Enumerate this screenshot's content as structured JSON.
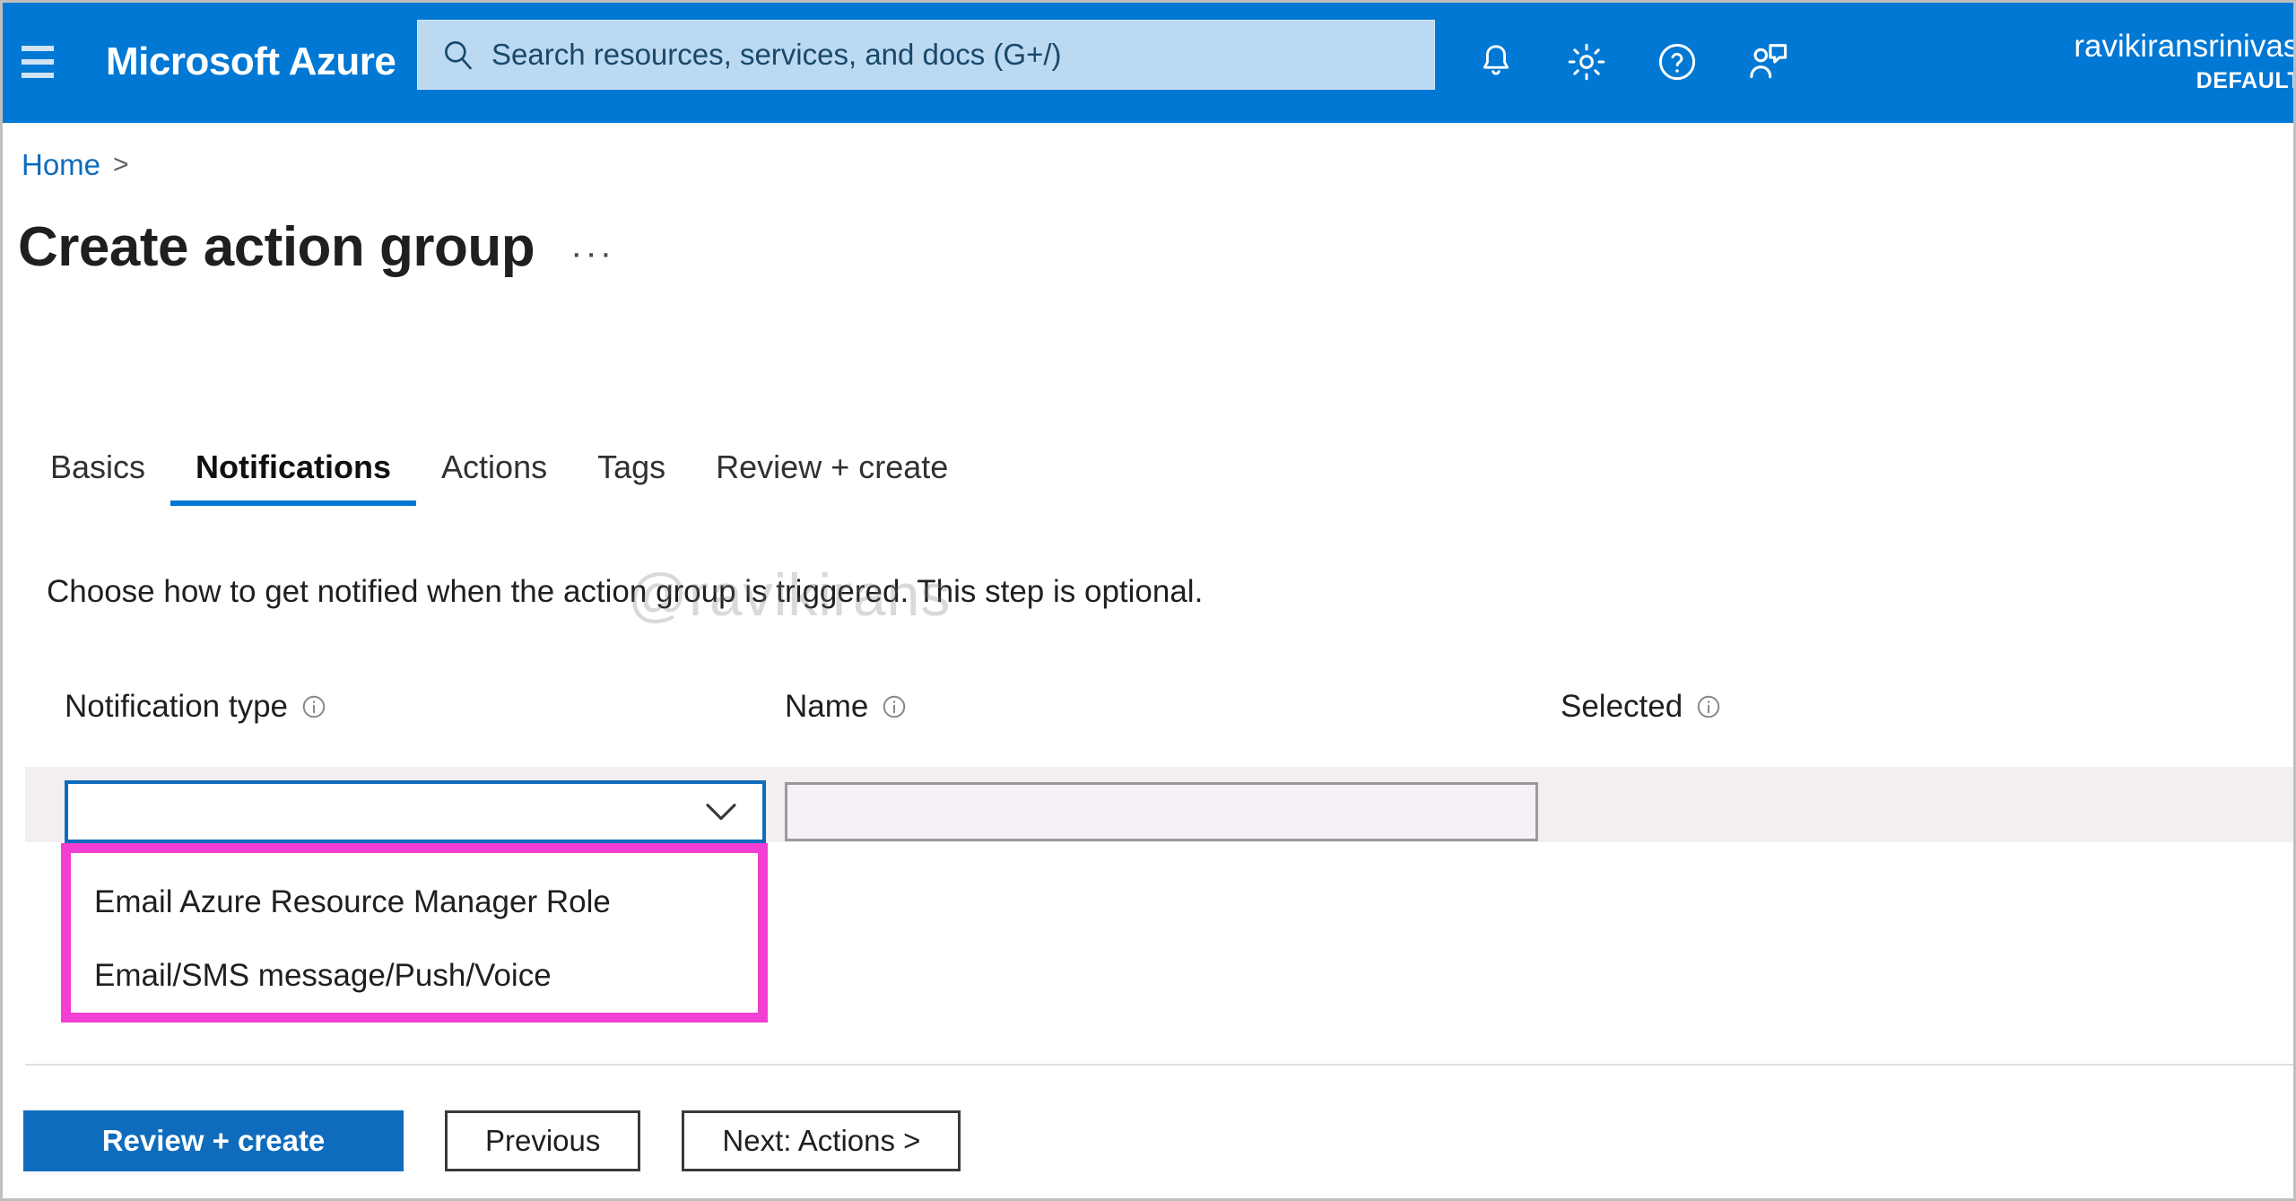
{
  "topbar": {
    "menu_icon": "hamburger-icon",
    "brand": "Microsoft Azure",
    "search": {
      "placeholder": "Search resources, services, and docs (G+/)",
      "value": "",
      "icon": "search-icon"
    },
    "icons": [
      {
        "name": "notifications-bell-icon",
        "label": "Notifications"
      },
      {
        "name": "settings-gear-icon",
        "label": "Settings"
      },
      {
        "name": "help-question-icon",
        "label": "Help"
      },
      {
        "name": "feedback-person-icon",
        "label": "Feedback"
      }
    ],
    "account": {
      "name": "ravikiransrinivasulu",
      "directory": "DEFAULT DI"
    },
    "accent_color": "#0078d4"
  },
  "breadcrumb": {
    "home": "Home",
    "separator": ">"
  },
  "page": {
    "title": "Create action group",
    "ellipsis": "···"
  },
  "tabs": [
    {
      "label": "Basics",
      "active": false
    },
    {
      "label": "Notifications",
      "active": true
    },
    {
      "label": "Actions",
      "active": false
    },
    {
      "label": "Tags",
      "active": false
    },
    {
      "label": "Review + create",
      "active": false
    }
  ],
  "content": {
    "description": "Choose how to get notified when the action group is triggered. This step is optional.",
    "watermark": "@ravikirans",
    "columns": [
      {
        "label": "Notification type",
        "info": "info-icon"
      },
      {
        "label": "Name",
        "info": "info-icon"
      },
      {
        "label": "Selected",
        "info": "info-icon"
      }
    ],
    "notification_type_dropdown": {
      "value": "",
      "placeholder": "",
      "chevron": "chevron-down-icon",
      "expanded": true,
      "options": [
        "Email Azure Resource Manager Role",
        "Email/SMS message/Push/Voice"
      ]
    },
    "name_field": {
      "value": "",
      "placeholder": "",
      "disabled": true
    },
    "selected_value": ""
  },
  "footer": {
    "primary_button": "Review + create",
    "previous_button": "Previous",
    "next_button": "Next: Actions >"
  },
  "colors": {
    "azure_blue": "#0078d4",
    "link_blue": "#0f6cbd",
    "highlight_magenta": "#f23ed2",
    "row_band": "#f2eef2"
  }
}
